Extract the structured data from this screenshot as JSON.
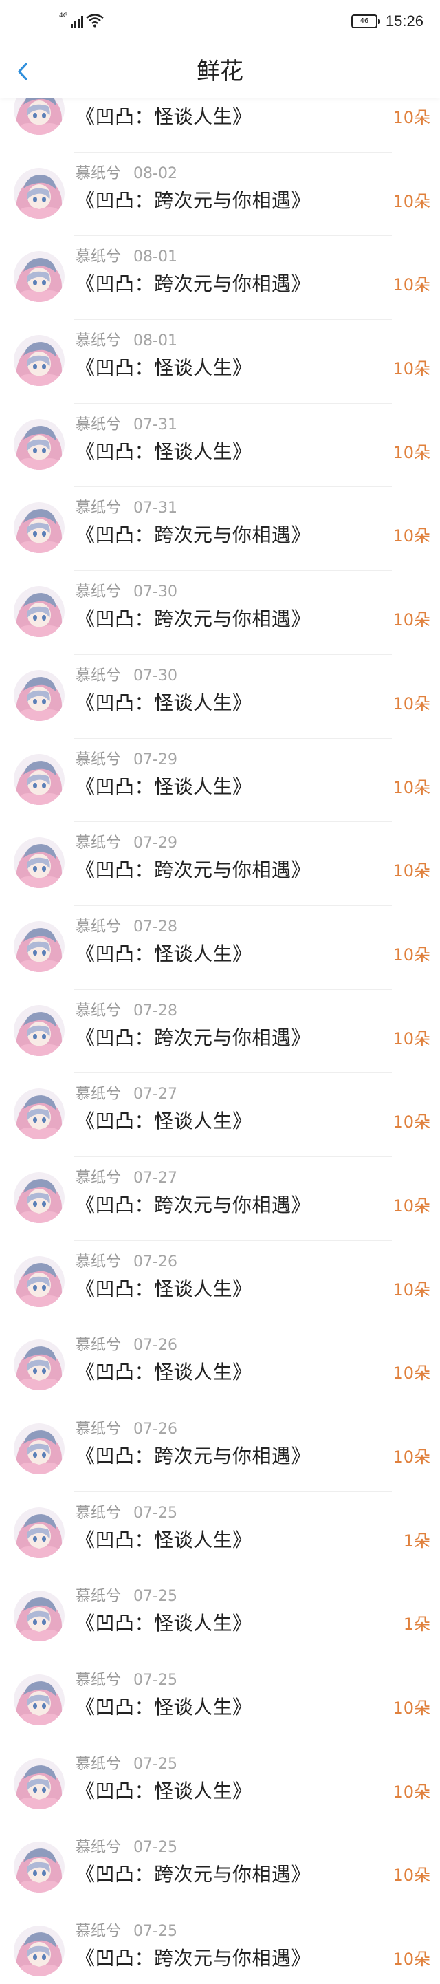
{
  "status_bar": {
    "network": "4G",
    "battery": "46",
    "time": "15:26"
  },
  "nav": {
    "title": "鲜花",
    "back_icon": "chevron-left-icon"
  },
  "colors": {
    "accent": "#2f8fdc",
    "count": "#e0803c",
    "meta": "#9a9a9a"
  },
  "items": [
    {
      "user": "慕纸兮",
      "date": "",
      "title": "《凹凸：怪谈人生》",
      "count": "10朵"
    },
    {
      "user": "慕纸兮",
      "date": "08-02",
      "title": "《凹凸：跨次元与你相遇》",
      "count": "10朵"
    },
    {
      "user": "慕纸兮",
      "date": "08-01",
      "title": "《凹凸：跨次元与你相遇》",
      "count": "10朵"
    },
    {
      "user": "慕纸兮",
      "date": "08-01",
      "title": "《凹凸：怪谈人生》",
      "count": "10朵"
    },
    {
      "user": "慕纸兮",
      "date": "07-31",
      "title": "《凹凸：怪谈人生》",
      "count": "10朵"
    },
    {
      "user": "慕纸兮",
      "date": "07-31",
      "title": "《凹凸：跨次元与你相遇》",
      "count": "10朵"
    },
    {
      "user": "慕纸兮",
      "date": "07-30",
      "title": "《凹凸：跨次元与你相遇》",
      "count": "10朵"
    },
    {
      "user": "慕纸兮",
      "date": "07-30",
      "title": "《凹凸：怪谈人生》",
      "count": "10朵"
    },
    {
      "user": "慕纸兮",
      "date": "07-29",
      "title": "《凹凸：怪谈人生》",
      "count": "10朵"
    },
    {
      "user": "慕纸兮",
      "date": "07-29",
      "title": "《凹凸：跨次元与你相遇》",
      "count": "10朵"
    },
    {
      "user": "慕纸兮",
      "date": "07-28",
      "title": "《凹凸：怪谈人生》",
      "count": "10朵"
    },
    {
      "user": "慕纸兮",
      "date": "07-28",
      "title": "《凹凸：跨次元与你相遇》",
      "count": "10朵"
    },
    {
      "user": "慕纸兮",
      "date": "07-27",
      "title": "《凹凸：怪谈人生》",
      "count": "10朵"
    },
    {
      "user": "慕纸兮",
      "date": "07-27",
      "title": "《凹凸：跨次元与你相遇》",
      "count": "10朵"
    },
    {
      "user": "慕纸兮",
      "date": "07-26",
      "title": "《凹凸：怪谈人生》",
      "count": "10朵"
    },
    {
      "user": "慕纸兮",
      "date": "07-26",
      "title": "《凹凸：怪谈人生》",
      "count": "10朵"
    },
    {
      "user": "慕纸兮",
      "date": "07-26",
      "title": "《凹凸：跨次元与你相遇》",
      "count": "10朵"
    },
    {
      "user": "慕纸兮",
      "date": "07-25",
      "title": "《凹凸：怪谈人生》",
      "count": "1朵"
    },
    {
      "user": "慕纸兮",
      "date": "07-25",
      "title": "《凹凸：怪谈人生》",
      "count": "1朵"
    },
    {
      "user": "慕纸兮",
      "date": "07-25",
      "title": "《凹凸：怪谈人生》",
      "count": "10朵"
    },
    {
      "user": "慕纸兮",
      "date": "07-25",
      "title": "《凹凸：怪谈人生》",
      "count": "10朵"
    },
    {
      "user": "慕纸兮",
      "date": "07-25",
      "title": "《凹凸：跨次元与你相遇》",
      "count": "10朵"
    },
    {
      "user": "慕纸兮",
      "date": "07-25",
      "title": "《凹凸：跨次元与你相遇》",
      "count": "10朵"
    }
  ]
}
